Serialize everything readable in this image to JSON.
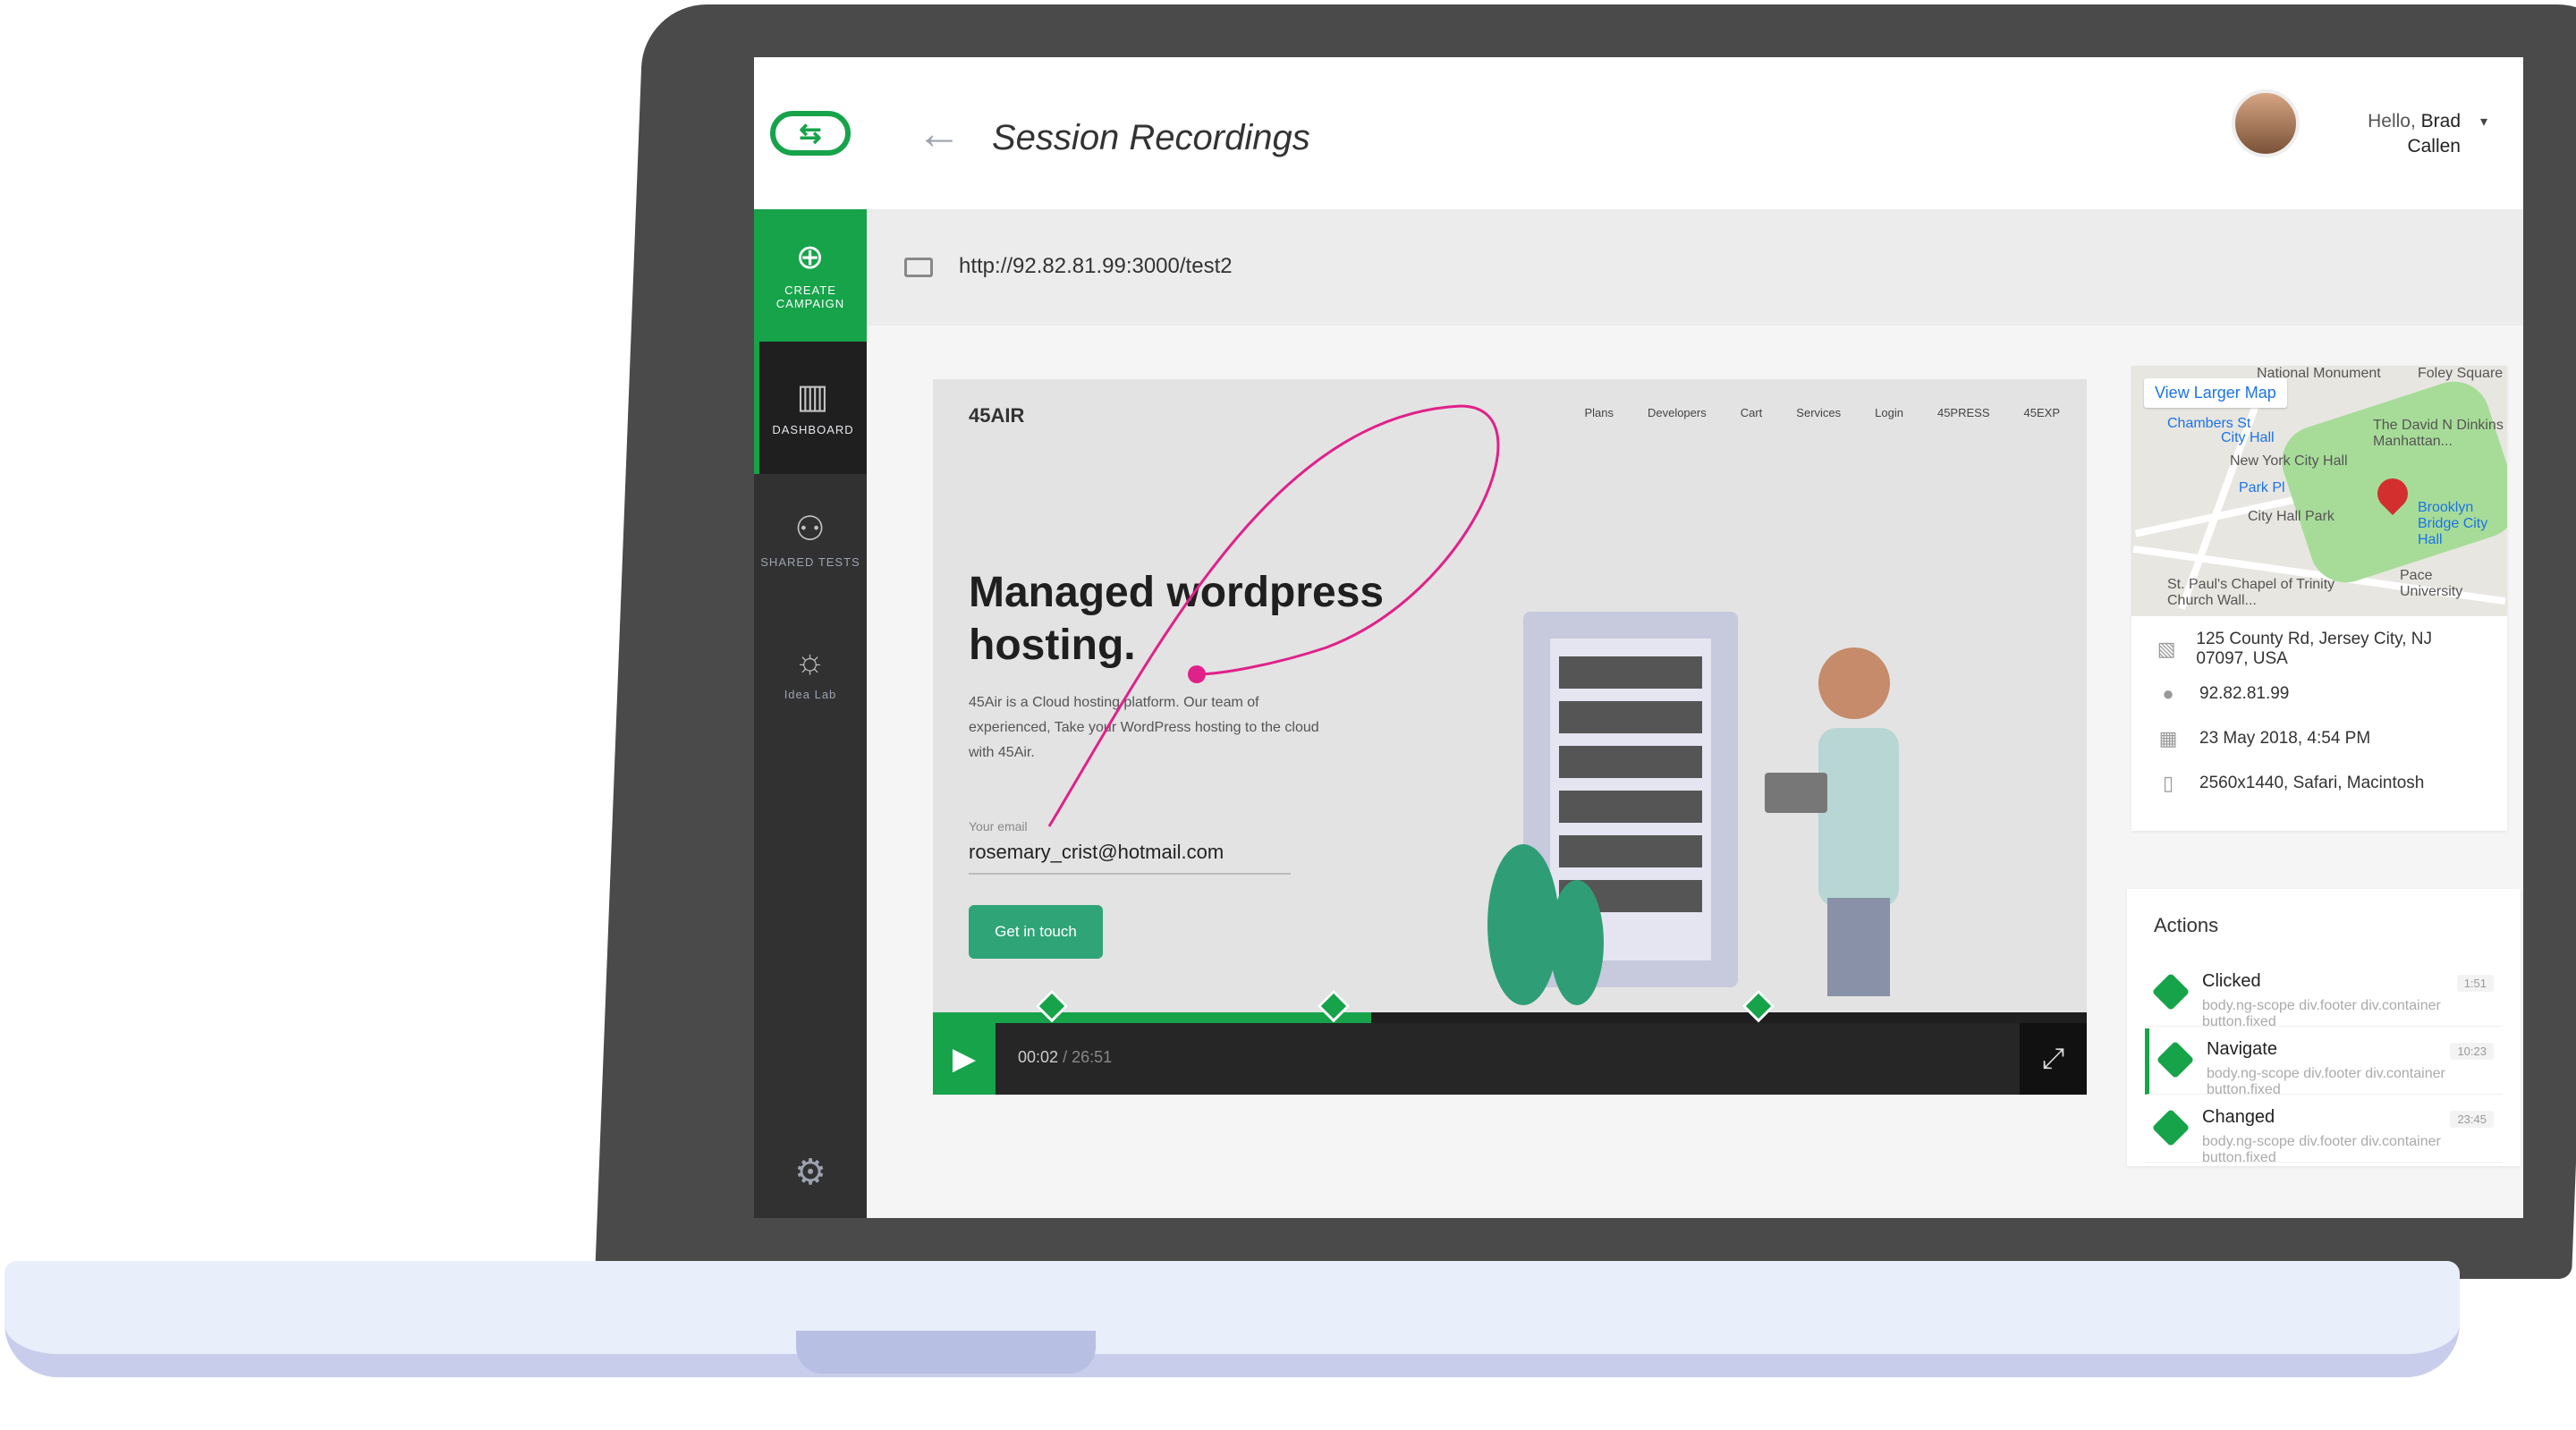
{
  "header": {
    "title": "Session Recordings",
    "greeting": "Hello,",
    "user_first": "Brad",
    "user_last": "Callen"
  },
  "sidebar": {
    "items": [
      {
        "label": "CREATE CAMPAIGN",
        "icon": "plus-circle-icon"
      },
      {
        "label": "DASHBOARD",
        "icon": "dashboard-icon"
      },
      {
        "label": "SHARED TESTS",
        "icon": "users-icon"
      },
      {
        "label": "Idea Lab",
        "icon": "lightbulb-icon"
      }
    ],
    "settings_icon": "gear-icon"
  },
  "url": "http://92.82.81.99:3000/test2",
  "player": {
    "site": {
      "brand": "45AIR",
      "nav": [
        "Plans",
        "Developers",
        "Cart",
        "Services",
        "Login",
        "45PRESS",
        "45EXP"
      ],
      "hero_title_1": "Managed wordpress",
      "hero_title_2": "hosting.",
      "hero_desc": "45Air is a Cloud hosting platform. Our team of experienced, Take your WordPress hosting to the cloud with 45Air.",
      "email_label": "Your email",
      "email_value": "rosemary_crist@hotmail.com",
      "cta": "Get in touch"
    },
    "current_time": "00:02",
    "total_time": "26:51",
    "progress": 0.38
  },
  "info": {
    "map_link": "View Larger Map",
    "map_labels": [
      "New York City Hall",
      "City Hall Park",
      "The David N Dinkins Manhattan...",
      "St. Paul's Chapel of Trinity Church Wall...",
      "Pace University",
      "Brooklyn Bridge City Hall",
      "Park Pl",
      "Chambers St",
      "National Monument",
      "Foley Square",
      "City Hall"
    ],
    "address": "125 County Rd, Jersey City, NJ 07097, USA",
    "ip": "92.82.81.99",
    "date": "23 May 2018, 4:54 PM",
    "device": "2560x1440, Safari, Macintosh"
  },
  "actions": {
    "title": "Actions",
    "items": [
      {
        "name": "Clicked",
        "selector": "body.ng-scope div.footer div.container button.fixed",
        "time": "1:51"
      },
      {
        "name": "Navigate",
        "selector": "body.ng-scope div.footer div.container button.fixed",
        "time": "10:23"
      },
      {
        "name": "Changed",
        "selector": "body.ng-scope div.footer div.container button.fixed",
        "time": "23:45"
      }
    ]
  },
  "colors": {
    "accent": "#16a34a",
    "sidebar": "#313131",
    "cursor_path": "#e0218a"
  }
}
